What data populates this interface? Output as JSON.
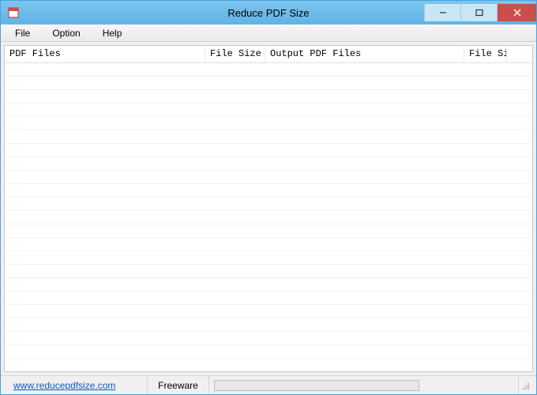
{
  "window": {
    "title": "Reduce PDF Size"
  },
  "menu": {
    "file": "File",
    "option": "Option",
    "help": "Help"
  },
  "columns": {
    "c1": "PDF Files",
    "c2": "File Size",
    "c3": "Output PDF Files",
    "c4": "File Size"
  },
  "status": {
    "link": "www.reducepdfsize.com",
    "license": "Freeware"
  }
}
